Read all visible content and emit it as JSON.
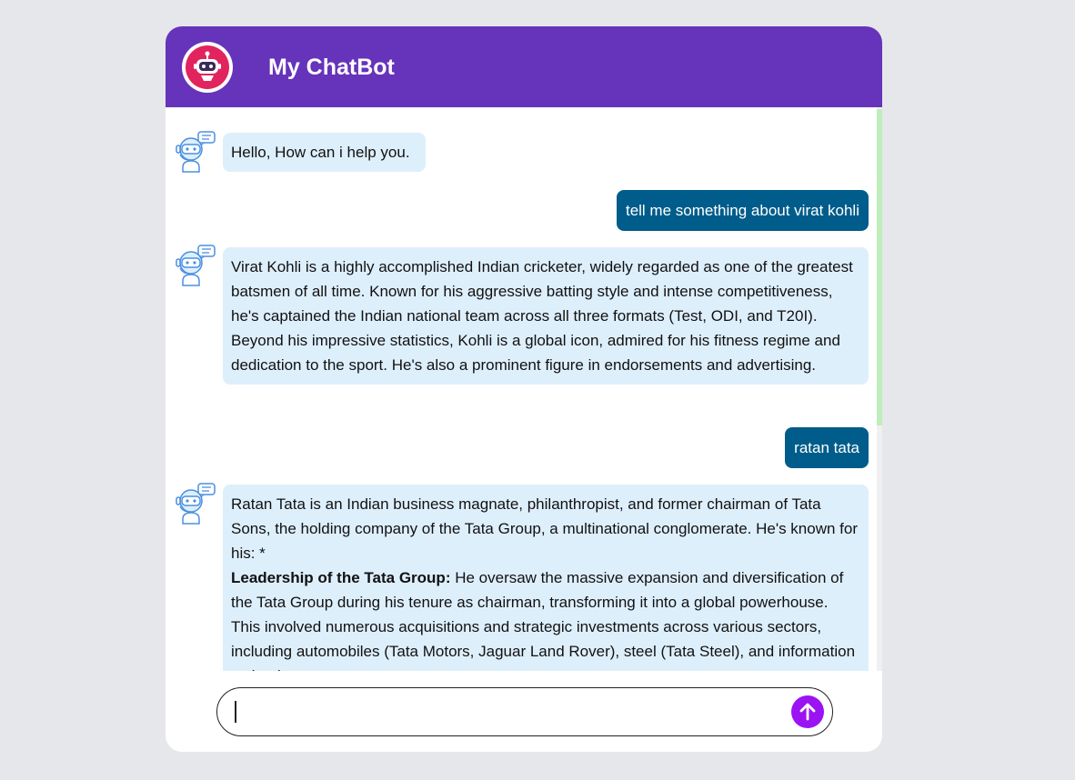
{
  "header": {
    "title": "My ChatBot",
    "logo_icon": "robot-icon"
  },
  "messages": [
    {
      "sender": "bot",
      "text": "Hello, How can i help you."
    },
    {
      "sender": "user",
      "text": "tell me something about virat kohli"
    },
    {
      "sender": "bot",
      "text": "Virat Kohli is a highly accomplished Indian cricketer, widely regarded as one of the greatest batsmen of all time. Known for his aggressive batting style and intense competitiveness, he's captained the Indian national team across all three formats (Test, ODI, and T20I). Beyond his impressive statistics, Kohli is a global icon, admired for his fitness regime and dedication to the sport. He's also a prominent figure in endorsements and advertising."
    },
    {
      "sender": "user",
      "text": "ratan tata"
    },
    {
      "sender": "bot",
      "intro": "Ratan Tata is an Indian business magnate, philanthropist, and former chairman of Tata Sons, the holding company of the Tata Group, a multinational conglomerate. He's known for his: *",
      "bold": "Leadership of the Tata Group:",
      "rest": " He oversaw the massive expansion and diversification of the Tata Group during his tenure as chairman, transforming it into a global powerhouse. This involved numerous acquisitions and strategic investments across various sectors, including automobiles (Tata Motors, Jaguar Land Rover), steel (Tata Steel), and information technology."
    }
  ],
  "input": {
    "value": "",
    "placeholder": ""
  },
  "send_icon": "arrow-up-icon",
  "colors": {
    "header": "#6633bb",
    "bot_bubble": "#deeffc",
    "user_bubble": "#005c8a",
    "send_button": "#9b13f2",
    "logo": "#e2245e"
  }
}
